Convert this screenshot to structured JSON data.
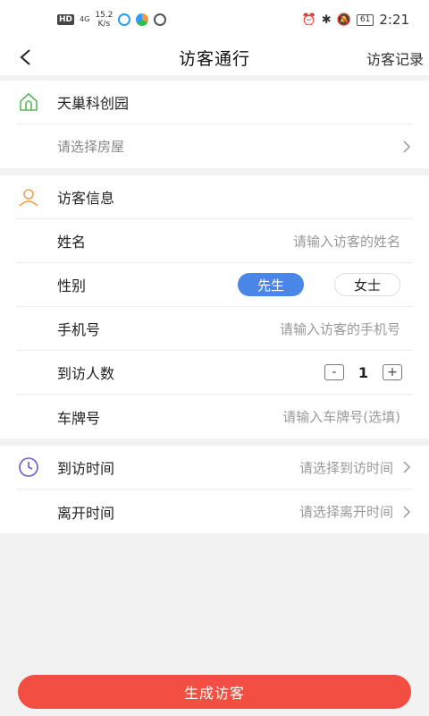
{
  "status_bar": {
    "hd": "HD",
    "signal": "4G",
    "speed_value": "15.2",
    "speed_unit": "K/s",
    "battery": "61",
    "time": "2:21"
  },
  "nav": {
    "title": "访客通行",
    "record_label": "访客记录"
  },
  "community": {
    "name": "天巢科创园",
    "house_hint": "请选择房屋",
    "icon_color": "#5cb85c"
  },
  "visitor": {
    "header": "访客信息",
    "icon_color": "#f0a050",
    "name_label": "姓名",
    "name_placeholder": "请输入访客的姓名",
    "gender_label": "性别",
    "gender_male": "先生",
    "gender_female": "女士",
    "gender_selected": "先生",
    "phone_label": "手机号",
    "phone_placeholder": "请输入访客的手机号",
    "count_label": "到访人数",
    "count_minus": "-",
    "count_value": "1",
    "count_plus": "+",
    "plate_label": "车牌号",
    "plate_placeholder": "请输入车牌号(选填)"
  },
  "time": {
    "icon_color": "#6a5acd",
    "arrive_label": "到访时间",
    "arrive_placeholder": "请选择到访时间",
    "leave_label": "离开时间",
    "leave_placeholder": "请选择离开时间"
  },
  "submit_label": "生成访客",
  "colors": {
    "accent_blue": "#4a86e8",
    "submit_red": "#f24e42"
  }
}
